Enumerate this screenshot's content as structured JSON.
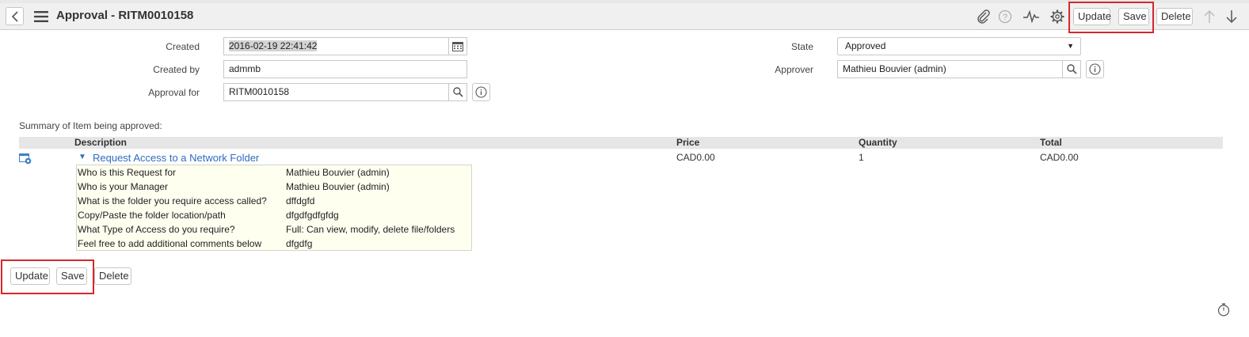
{
  "header": {
    "title": "Approval - RITM0010158",
    "buttons": {
      "update": "Update",
      "save": "Save",
      "delete": "Delete"
    },
    "icons": [
      "back-icon",
      "menu-icon",
      "paperclip-icon",
      "help-icon",
      "activity-icon",
      "gear-icon",
      "arrow-up-icon",
      "arrow-down-icon"
    ]
  },
  "form": {
    "created": {
      "label": "Created",
      "value": "2016-02-19 22:41:42"
    },
    "created_by": {
      "label": "Created by",
      "value": "admmb"
    },
    "approval_for": {
      "label": "Approval for",
      "value": "RITM0010158"
    },
    "state": {
      "label": "State",
      "value": "Approved"
    },
    "approver": {
      "label": "Approver",
      "value": "Mathieu Bouvier (admin)"
    }
  },
  "summary": {
    "label": "Summary of Item being approved:",
    "columns": {
      "description": "Description",
      "price": "Price",
      "quantity": "Quantity",
      "total": "Total"
    },
    "item": {
      "name": "Request Access to a Network Folder",
      "price": "CAD0.00",
      "quantity": "1",
      "total": "CAD0.00"
    },
    "details": [
      {
        "q": "Who is this Request for",
        "a": "Mathieu Bouvier (admin)"
      },
      {
        "q": "Who is your Manager",
        "a": "Mathieu Bouvier (admin)"
      },
      {
        "q": "What is the folder you require access called?",
        "a": "dffdgfd"
      },
      {
        "q": "Copy/Paste the folder location/path",
        "a": "dfgdfgdfgfdg"
      },
      {
        "q": "What Type of Access do you require?",
        "a": "Full: Can view, modify, delete file/folders"
      },
      {
        "q": "Feel free to add additional comments below",
        "a": "dfgdfg"
      }
    ]
  },
  "footer": {
    "buttons": {
      "update": "Update",
      "save": "Save",
      "delete": "Delete"
    }
  },
  "colors": {
    "highlight": "#d9262c",
    "link": "#2e6cc0",
    "details_bg": "#fffff0"
  }
}
